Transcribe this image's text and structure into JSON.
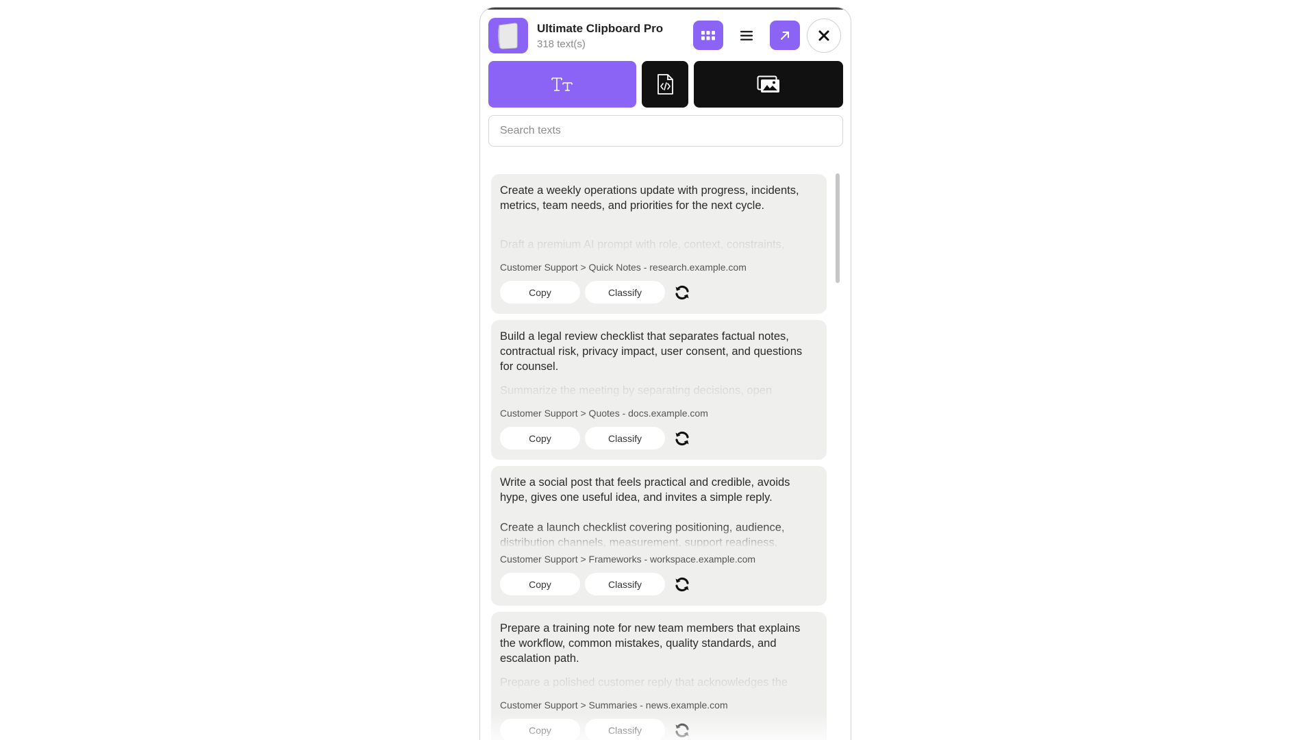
{
  "app": {
    "title": "Ultimate Clipboard Pro",
    "count": "318 text(s)",
    "accent": "#8b63f5",
    "logo_icon": "document-icon"
  },
  "header_buttons": [
    {
      "icon": "grid-icon"
    },
    {
      "icon": "menu-icon"
    },
    {
      "icon": "expand-icon"
    },
    {
      "icon": "close-icon"
    }
  ],
  "tabs": [
    {
      "icon": "text-icon",
      "active": true
    },
    {
      "icon": "code-file-icon",
      "active": false
    },
    {
      "icon": "image-gallery-icon",
      "active": false
    }
  ],
  "search": {
    "placeholder": "Search texts",
    "value": ""
  },
  "cards": [
    {
      "text": "Create a weekly operations update with progress, incidents, metrics, team needs, and priorities for the next cycle.",
      "secondary": "Draft a premium AI prompt with role, context, constraints,",
      "category": "Customer Support > Quick Notes - ",
      "source": "research.example.com",
      "copy_label": "Copy",
      "classify_label": "Classify"
    },
    {
      "text": "Build a legal review checklist that separates factual notes, contractual risk, privacy impact, user consent, and questions for counsel.",
      "secondary": "Summarize the meeting by separating decisions, open",
      "category": "Customer Support > Quotes - ",
      "source": "docs.example.com",
      "copy_label": "Copy",
      "classify_label": "Classify"
    },
    {
      "text": "Write a social post that feels practical and credible, avoids hype, gives one useful idea, and invites a simple reply.",
      "secondary": "Create a launch checklist covering positioning, audience, distribution channels, measurement, support readiness,",
      "category": "Customer Support > Frameworks - ",
      "source": "workspace.example.com",
      "copy_label": "Copy",
      "classify_label": "Classify"
    },
    {
      "text": "Prepare a training note for new team members that explains the workflow, common mistakes, quality standards, and escalation path.",
      "secondary": "Prepare a polished customer reply that acknowledges the",
      "category": "Customer Support > Summaries - ",
      "source": "news.example.com",
      "copy_label": "Copy",
      "classify_label": "Classify"
    }
  ]
}
